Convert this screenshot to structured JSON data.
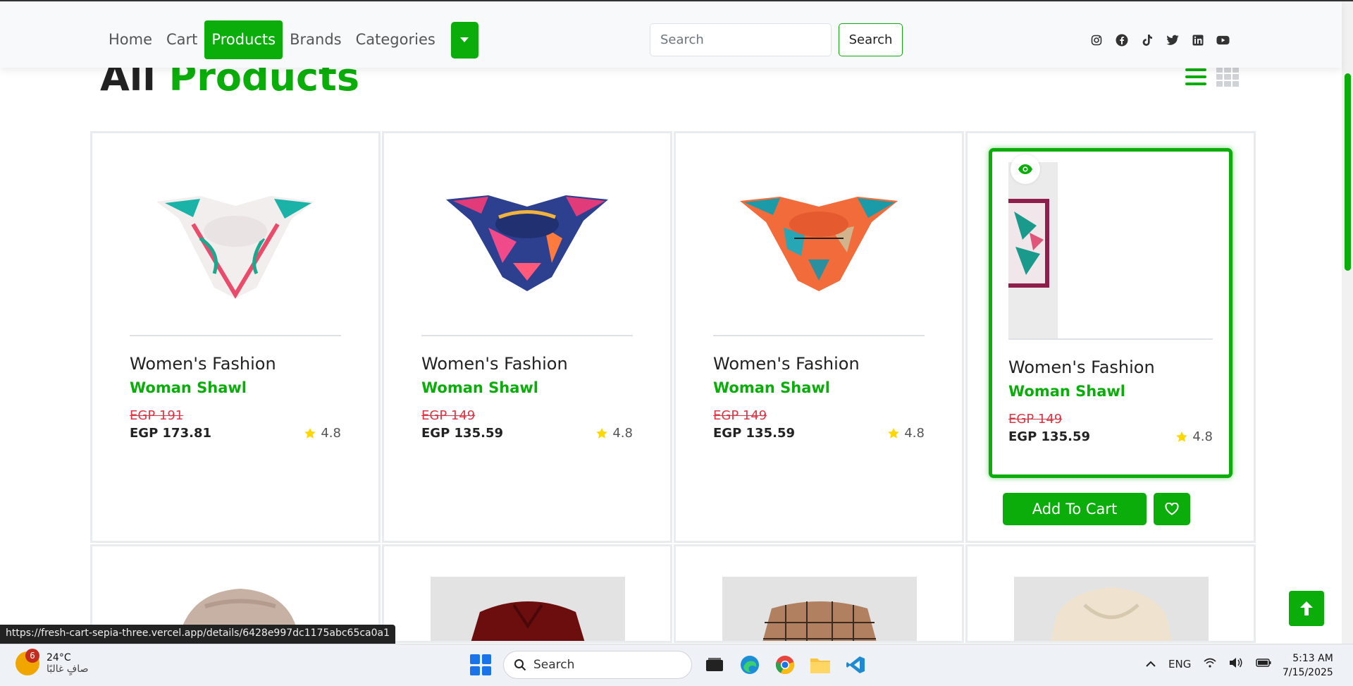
{
  "nav": {
    "links": [
      "Home",
      "Cart",
      "Products",
      "Brands",
      "Categories"
    ],
    "active": "Products",
    "search_placeholder": "Search",
    "search_button": "Search"
  },
  "socials": [
    "instagram-icon",
    "facebook-icon",
    "tiktok-icon",
    "twitter-icon",
    "linkedin-icon",
    "youtube-icon"
  ],
  "page": {
    "title_plain": "All",
    "title_accent": "Products"
  },
  "products": [
    {
      "category": "Women's Fashion",
      "title": "Woman Shawl",
      "old_price": "EGP 191",
      "price": "EGP 173.81",
      "rating": "4.8"
    },
    {
      "category": "Women's Fashion",
      "title": "Woman Shawl",
      "old_price": "EGP 149",
      "price": "EGP 135.59",
      "rating": "4.8"
    },
    {
      "category": "Women's Fashion",
      "title": "Woman Shawl",
      "old_price": "EGP 149",
      "price": "EGP 135.59",
      "rating": "4.8"
    },
    {
      "category": "Women's Fashion",
      "title": "Woman Shawl",
      "old_price": "EGP 149",
      "price": "EGP 135.59",
      "rating": "4.8"
    }
  ],
  "hover_actions": {
    "add_to_cart": "Add To Cart"
  },
  "status_url": "https://fresh-cart-sepia-three.vercel.app/details/6428e997dc1175abc65ca0a1",
  "taskbar": {
    "weather_badge": "6",
    "temperature": "24°C",
    "weather_desc": "صافٍ غالبًا",
    "search": "Search",
    "lang": "ENG",
    "time": "5:13 AM",
    "date": "7/15/2025"
  },
  "colors": {
    "brand": "#0aad0a",
    "sale": "#dc3545"
  }
}
